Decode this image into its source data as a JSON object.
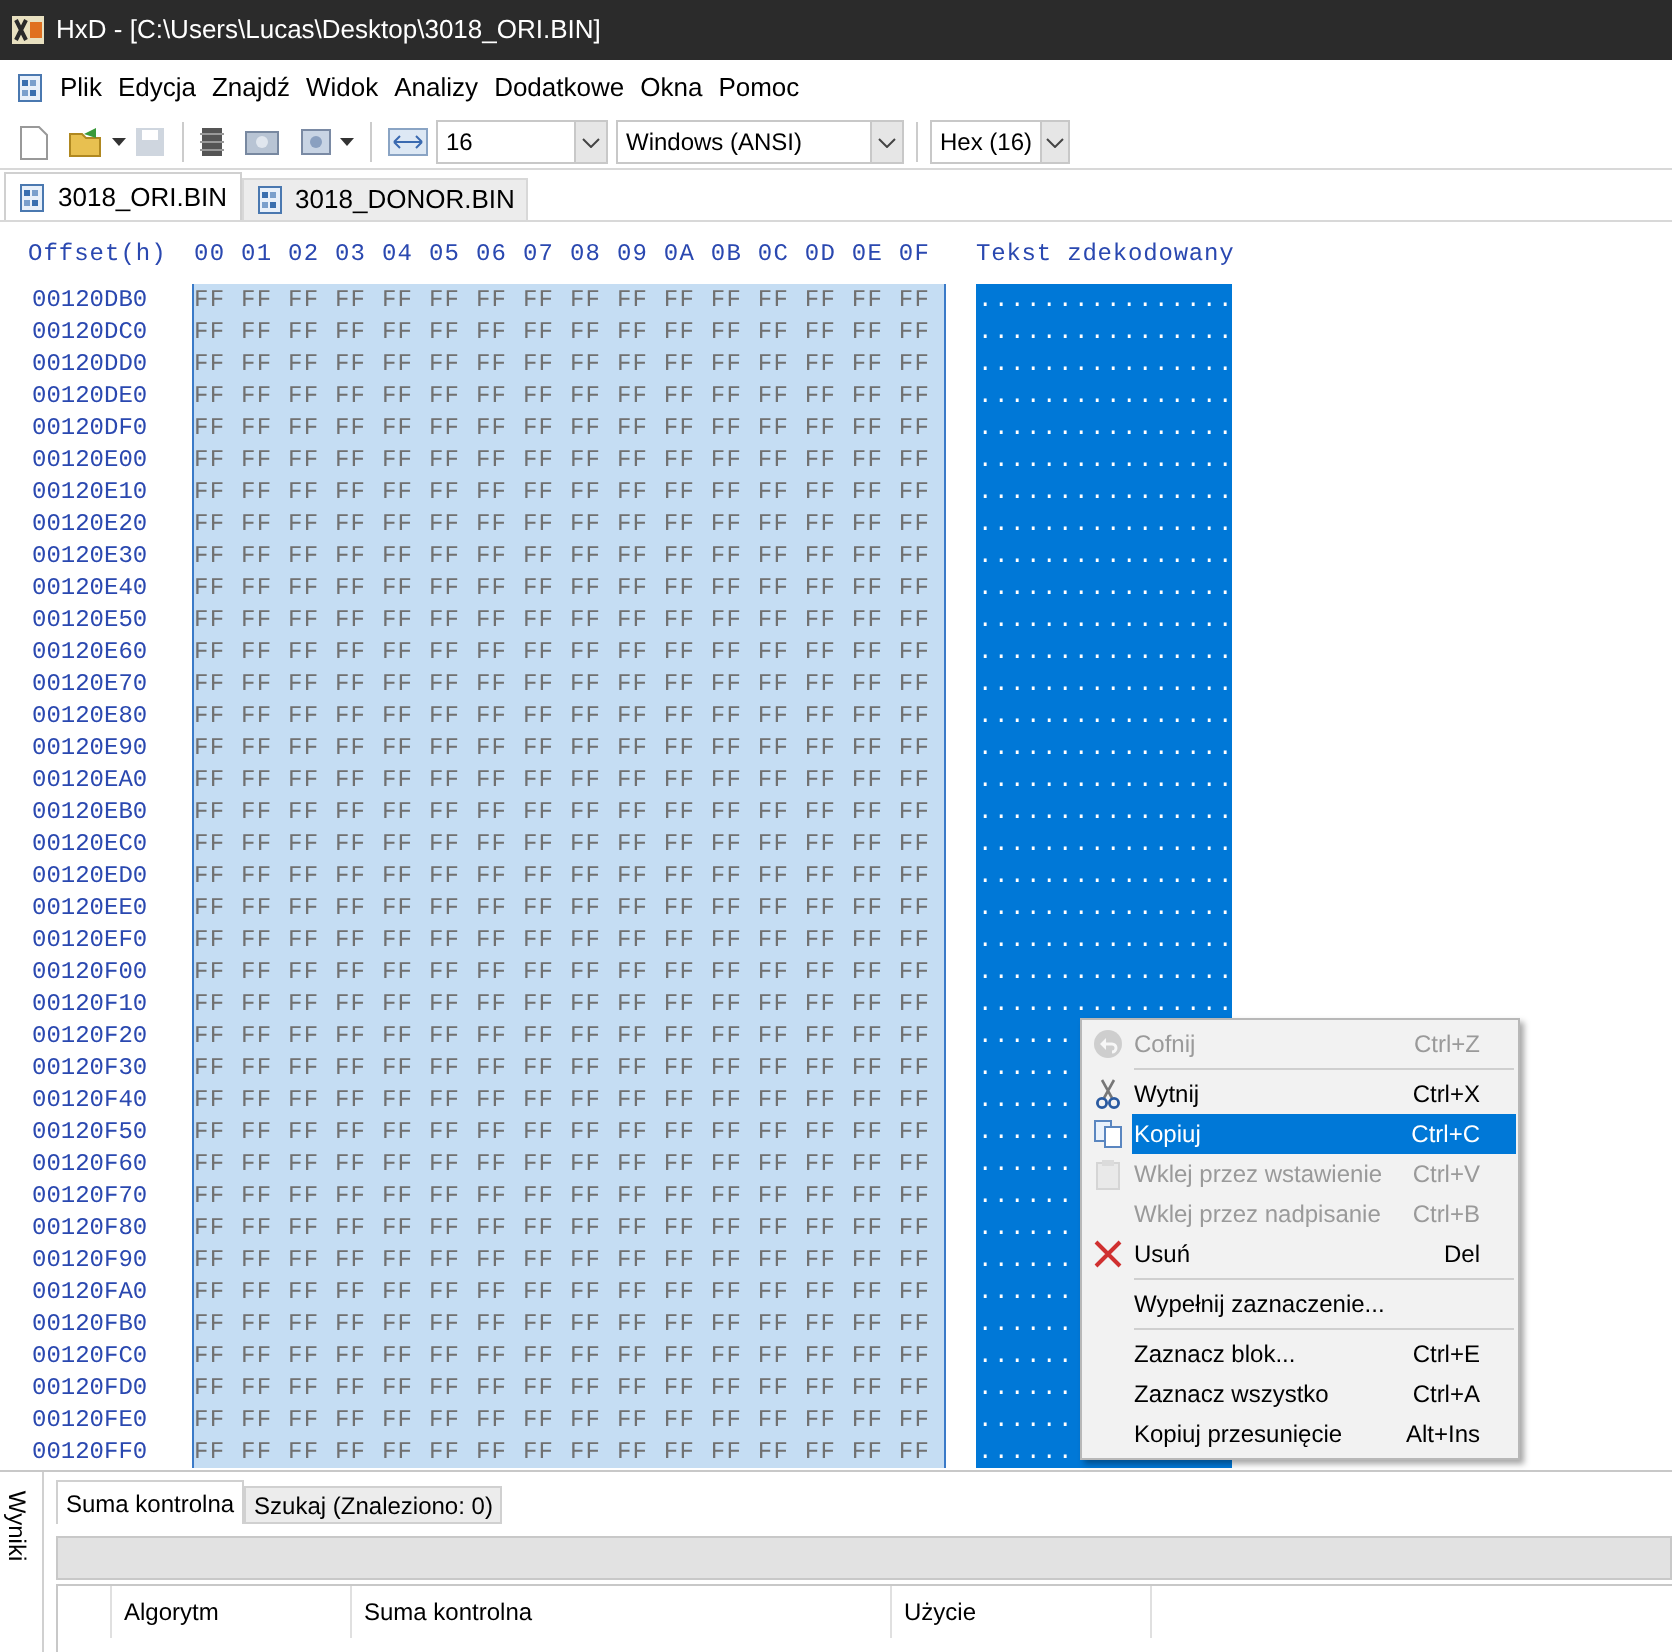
{
  "window": {
    "title": "HxD - [C:\\Users\\Lucas\\Desktop\\3018_ORI.BIN]"
  },
  "menu_bar": [
    "Plik",
    "Edycja",
    "Znajdź",
    "Widok",
    "Analizy",
    "Dodatkowe",
    "Okna",
    "Pomoc"
  ],
  "toolbar": {
    "bytes_per_row": "16",
    "charset": "Windows (ANSI)",
    "offset_base": "Hex (16)"
  },
  "tabs": [
    {
      "label": "3018_ORI.BIN",
      "selected": true
    },
    {
      "label": "3018_DONOR.BIN",
      "selected": false
    }
  ],
  "editor": {
    "offset_header": "Offset(h)",
    "column_header": "00 01 02 03 04 05 06 07 08 09 0A 0B 0C 0D 0E 0F",
    "text_header": "Tekst zdekodowany",
    "rows": [
      {
        "offset": "00120DB0",
        "hex": "FF FF FF FF FF FF FF FF FF FF FF FF FF FF FF FF",
        "text": "................"
      },
      {
        "offset": "00120DC0",
        "hex": "FF FF FF FF FF FF FF FF FF FF FF FF FF FF FF FF",
        "text": "................"
      },
      {
        "offset": "00120DD0",
        "hex": "FF FF FF FF FF FF FF FF FF FF FF FF FF FF FF FF",
        "text": "................"
      },
      {
        "offset": "00120DE0",
        "hex": "FF FF FF FF FF FF FF FF FF FF FF FF FF FF FF FF",
        "text": "................"
      },
      {
        "offset": "00120DF0",
        "hex": "FF FF FF FF FF FF FF FF FF FF FF FF FF FF FF FF",
        "text": "................"
      },
      {
        "offset": "00120E00",
        "hex": "FF FF FF FF FF FF FF FF FF FF FF FF FF FF FF FF",
        "text": "................"
      },
      {
        "offset": "00120E10",
        "hex": "FF FF FF FF FF FF FF FF FF FF FF FF FF FF FF FF",
        "text": "................"
      },
      {
        "offset": "00120E20",
        "hex": "FF FF FF FF FF FF FF FF FF FF FF FF FF FF FF FF",
        "text": "................"
      },
      {
        "offset": "00120E30",
        "hex": "FF FF FF FF FF FF FF FF FF FF FF FF FF FF FF FF",
        "text": "................"
      },
      {
        "offset": "00120E40",
        "hex": "FF FF FF FF FF FF FF FF FF FF FF FF FF FF FF FF",
        "text": "................"
      },
      {
        "offset": "00120E50",
        "hex": "FF FF FF FF FF FF FF FF FF FF FF FF FF FF FF FF",
        "text": "................"
      },
      {
        "offset": "00120E60",
        "hex": "FF FF FF FF FF FF FF FF FF FF FF FF FF FF FF FF",
        "text": "................"
      },
      {
        "offset": "00120E70",
        "hex": "FF FF FF FF FF FF FF FF FF FF FF FF FF FF FF FF",
        "text": "................"
      },
      {
        "offset": "00120E80",
        "hex": "FF FF FF FF FF FF FF FF FF FF FF FF FF FF FF FF",
        "text": "................"
      },
      {
        "offset": "00120E90",
        "hex": "FF FF FF FF FF FF FF FF FF FF FF FF FF FF FF FF",
        "text": "................"
      },
      {
        "offset": "00120EA0",
        "hex": "FF FF FF FF FF FF FF FF FF FF FF FF FF FF FF FF",
        "text": "................"
      },
      {
        "offset": "00120EB0",
        "hex": "FF FF FF FF FF FF FF FF FF FF FF FF FF FF FF FF",
        "text": "................"
      },
      {
        "offset": "00120EC0",
        "hex": "FF FF FF FF FF FF FF FF FF FF FF FF FF FF FF FF",
        "text": "................"
      },
      {
        "offset": "00120ED0",
        "hex": "FF FF FF FF FF FF FF FF FF FF FF FF FF FF FF FF",
        "text": "................"
      },
      {
        "offset": "00120EE0",
        "hex": "FF FF FF FF FF FF FF FF FF FF FF FF FF FF FF FF",
        "text": "................"
      },
      {
        "offset": "00120EF0",
        "hex": "FF FF FF FF FF FF FF FF FF FF FF FF FF FF FF FF",
        "text": "................"
      },
      {
        "offset": "00120F00",
        "hex": "FF FF FF FF FF FF FF FF FF FF FF FF FF FF FF FF",
        "text": "................"
      },
      {
        "offset": "00120F10",
        "hex": "FF FF FF FF FF FF FF FF FF FF FF FF FF FF FF FF",
        "text": "................"
      },
      {
        "offset": "00120F20",
        "hex": "FF FF FF FF FF FF FF FF FF FF FF FF FF FF FF FF",
        "text": "......"
      },
      {
        "offset": "00120F30",
        "hex": "FF FF FF FF FF FF FF FF FF FF FF FF FF FF FF FF",
        "text": "......"
      },
      {
        "offset": "00120F40",
        "hex": "FF FF FF FF FF FF FF FF FF FF FF FF FF FF FF FF",
        "text": "......"
      },
      {
        "offset": "00120F50",
        "hex": "FF FF FF FF FF FF FF FF FF FF FF FF FF FF FF FF",
        "text": "......"
      },
      {
        "offset": "00120F60",
        "hex": "FF FF FF FF FF FF FF FF FF FF FF FF FF FF FF FF",
        "text": "......"
      },
      {
        "offset": "00120F70",
        "hex": "FF FF FF FF FF FF FF FF FF FF FF FF FF FF FF FF",
        "text": "......"
      },
      {
        "offset": "00120F80",
        "hex": "FF FF FF FF FF FF FF FF FF FF FF FF FF FF FF FF",
        "text": "......"
      },
      {
        "offset": "00120F90",
        "hex": "FF FF FF FF FF FF FF FF FF FF FF FF FF FF FF FF",
        "text": "......"
      },
      {
        "offset": "00120FA0",
        "hex": "FF FF FF FF FF FF FF FF FF FF FF FF FF FF FF FF",
        "text": "......"
      },
      {
        "offset": "00120FB0",
        "hex": "FF FF FF FF FF FF FF FF FF FF FF FF FF FF FF FF",
        "text": "......"
      },
      {
        "offset": "00120FC0",
        "hex": "FF FF FF FF FF FF FF FF FF FF FF FF FF FF FF FF",
        "text": "......"
      },
      {
        "offset": "00120FD0",
        "hex": "FF FF FF FF FF FF FF FF FF FF FF FF FF FF FF FF",
        "text": "......"
      },
      {
        "offset": "00120FE0",
        "hex": "FF FF FF FF FF FF FF FF FF FF FF FF FF FF FF FF",
        "text": "......"
      },
      {
        "offset": "00120FF0",
        "hex": "FF FF FF FF FF FF FF FF FF FF FF FF FF FF FF FF",
        "text": "......"
      }
    ]
  },
  "context_menu": [
    {
      "kind": "item",
      "label": "Cofnij",
      "shortcut": "Ctrl+Z",
      "disabled": true,
      "selected": false
    },
    {
      "kind": "separator"
    },
    {
      "kind": "item",
      "label": "Wytnij",
      "shortcut": "Ctrl+X",
      "disabled": false,
      "selected": false
    },
    {
      "kind": "item",
      "label": "Kopiuj",
      "shortcut": "Ctrl+C",
      "disabled": false,
      "selected": true
    },
    {
      "kind": "item",
      "label": "Wklej przez wstawienie",
      "shortcut": "Ctrl+V",
      "disabled": true,
      "selected": false
    },
    {
      "kind": "item",
      "label": "Wklej przez nadpisanie",
      "shortcut": "Ctrl+B",
      "disabled": true,
      "selected": false
    },
    {
      "kind": "item",
      "label": "Usuń",
      "shortcut": "Del",
      "disabled": false,
      "selected": false
    },
    {
      "kind": "separator"
    },
    {
      "kind": "item",
      "label": "Wypełnij zaznaczenie...",
      "disabled": false,
      "selected": false
    },
    {
      "kind": "separator"
    },
    {
      "kind": "item",
      "label": "Zaznacz blok...",
      "shortcut": "Ctrl+E",
      "disabled": false,
      "selected": false
    },
    {
      "kind": "item",
      "label": "Zaznacz wszystko",
      "shortcut": "Ctrl+A",
      "disabled": false,
      "selected": false
    },
    {
      "kind": "item",
      "label": "Kopiuj przesunięcie",
      "shortcut": "Alt+Ins",
      "disabled": false,
      "selected": false
    }
  ],
  "results_panel": {
    "side_label": "Wyniki",
    "tabs": [
      {
        "label": "Suma kontrolna",
        "selected": true
      },
      {
        "label": "Szukaj (Znaleziono: 0)",
        "selected": false
      }
    ],
    "table": {
      "columns": [
        "Algorytm",
        "Suma kontrolna",
        "Użycie"
      ]
    }
  }
}
